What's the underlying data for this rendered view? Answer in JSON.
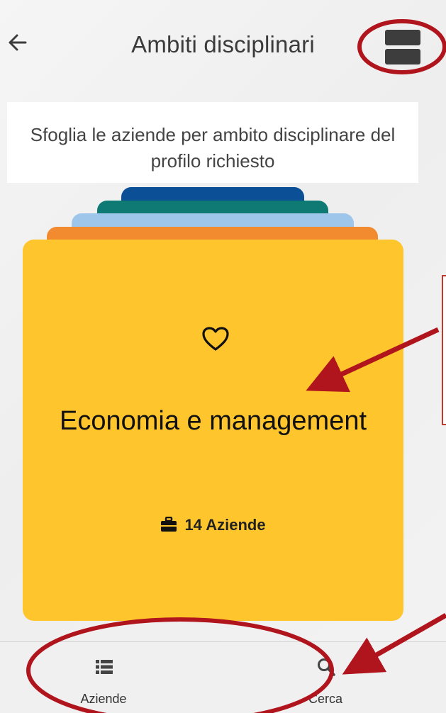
{
  "header": {
    "title": "Ambiti disciplinari"
  },
  "intro": {
    "text": "Sfoglia le aziende per ambito disciplinare del profilo richiesto"
  },
  "card": {
    "title": "Economia e management",
    "count": "14 Aziende",
    "color": "#ffc52c"
  },
  "stack_colors": [
    "#0b4f97",
    "#0f7a74",
    "#9ec6ea",
    "#f28b30"
  ],
  "bottom_nav": {
    "items": [
      {
        "label": "Aziende",
        "icon": "list-icon"
      },
      {
        "label": "Cerca",
        "icon": "search-icon"
      }
    ]
  },
  "annotation_color": "#b0141c"
}
